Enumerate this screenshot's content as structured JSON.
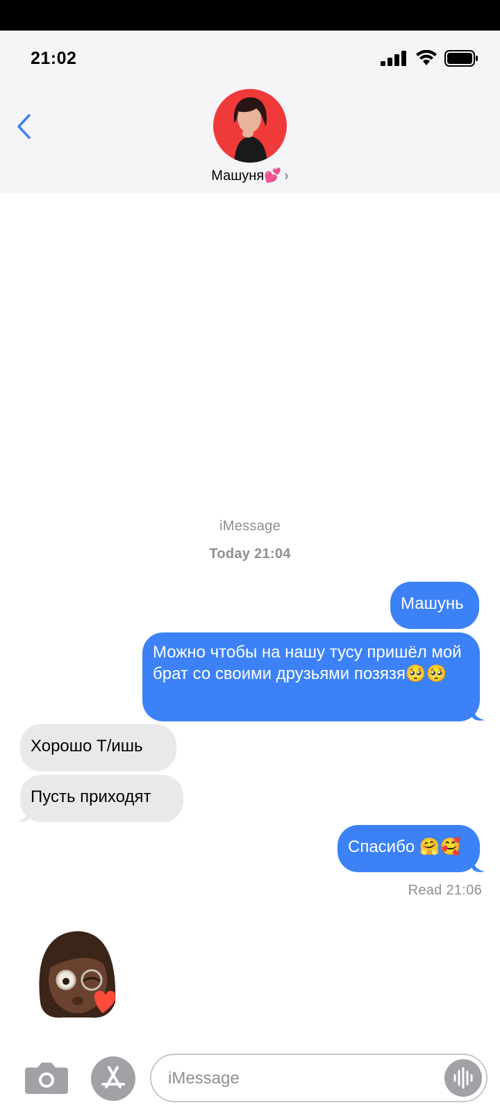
{
  "status": {
    "time": "21:02"
  },
  "contact": {
    "name": "Машуня💕",
    "chevron": "›"
  },
  "thread": {
    "service": "iMessage",
    "day": "Today",
    "time": "21:04"
  },
  "messages": [
    {
      "dir": "out",
      "text": "Машунь"
    },
    {
      "dir": "out",
      "text": "Можно  чтобы на нашу тусу пришёл мой  брат со своими друзьями позязя🥺🥺"
    },
    {
      "dir": "in",
      "text": "Хорошо  Т/ишь"
    },
    {
      "dir": "in",
      "text": "Пусть приходят"
    },
    {
      "dir": "out",
      "text": "Спасибо 🤗🥰"
    }
  ],
  "receipt": "Read 21:06",
  "composer": {
    "placeholder": "iMessage"
  },
  "icons": {
    "back": "chevron-left-icon",
    "signal": "cellular-signal-icon",
    "wifi": "wifi-icon",
    "battery": "battery-icon",
    "camera": "camera-icon",
    "appstore": "app-store-icon",
    "audio": "audio-waveform-icon"
  },
  "colors": {
    "accent": "#3c82f6",
    "incoming": "#e9e9eb",
    "muted": "#8e8e93",
    "header_bg": "#f5f4f7"
  }
}
